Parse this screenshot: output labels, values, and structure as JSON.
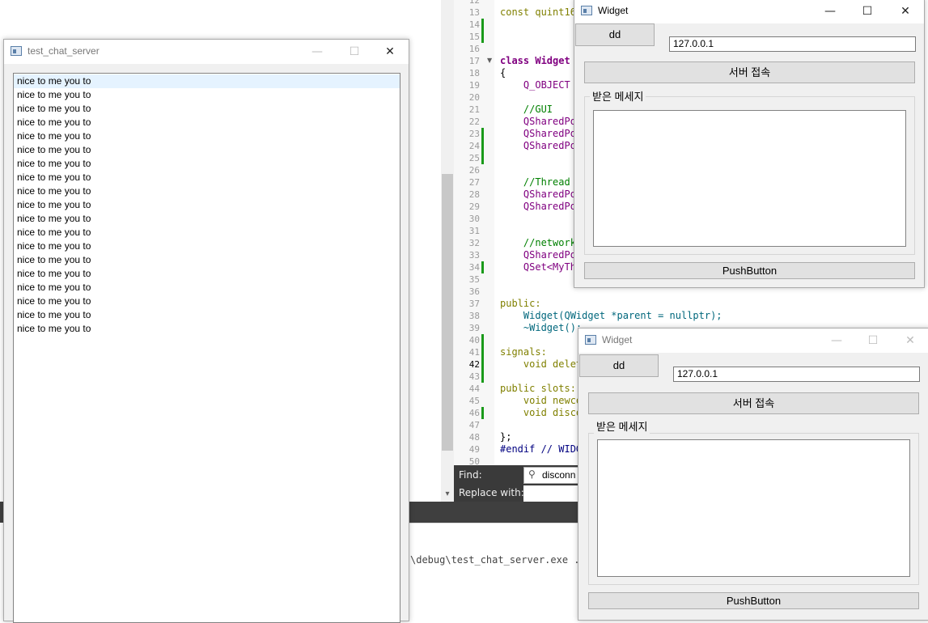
{
  "editor": {
    "lines": [
      {
        "no": "12",
        "code": ""
      },
      {
        "no": "13",
        "code": "const quint16"
      },
      {
        "no": "14",
        "code": ""
      },
      {
        "no": "15",
        "code": ""
      },
      {
        "no": "16",
        "code": ""
      },
      {
        "no": "17",
        "code": "class Widget"
      },
      {
        "no": "18",
        "code": "{"
      },
      {
        "no": "19",
        "code": "    Q_OBJECT"
      },
      {
        "no": "20",
        "code": ""
      },
      {
        "no": "21",
        "code": "    //GUI"
      },
      {
        "no": "22",
        "code": "    QSharedPo"
      },
      {
        "no": "23",
        "code": "    QSharedPo"
      },
      {
        "no": "24",
        "code": "    QSharedPo"
      },
      {
        "no": "25",
        "code": ""
      },
      {
        "no": "26",
        "code": ""
      },
      {
        "no": "27",
        "code": "    //Thread"
      },
      {
        "no": "28",
        "code": "    QSharedPo"
      },
      {
        "no": "29",
        "code": "    QSharedPo"
      },
      {
        "no": "30",
        "code": ""
      },
      {
        "no": "31",
        "code": ""
      },
      {
        "no": "32",
        "code": "    //network"
      },
      {
        "no": "33",
        "code": "    QSharedPo"
      },
      {
        "no": "34",
        "code": "    QSet<MyTh"
      },
      {
        "no": "35",
        "code": ""
      },
      {
        "no": "36",
        "code": ""
      },
      {
        "no": "37",
        "code": "public:"
      },
      {
        "no": "38",
        "code": "    Widget(QWidget *parent = nullptr);"
      },
      {
        "no": "39",
        "code": "    ~Widget();"
      },
      {
        "no": "40",
        "code": ""
      },
      {
        "no": "41",
        "code": "signals:"
      },
      {
        "no": "42",
        "code": "    void delet"
      },
      {
        "no": "43",
        "code": ""
      },
      {
        "no": "44",
        "code": "public slots:"
      },
      {
        "no": "45",
        "code": "    void newco"
      },
      {
        "no": "46",
        "code": "    void disco"
      },
      {
        "no": "47",
        "code": ""
      },
      {
        "no": "48",
        "code": "};"
      },
      {
        "no": "49",
        "code": "#endif // WIDG"
      },
      {
        "no": "50",
        "code": ""
      }
    ],
    "find_label": "Find:",
    "replace_label": "Replace with:",
    "find_value": "disconn",
    "output_line": "\\debug\\test_chat_server.exe ..."
  },
  "server_window": {
    "title": "test_chat_server",
    "items": [
      "nice to me you to",
      "nice to me you to",
      "nice to me you to",
      "nice to me you to",
      "nice to me you to",
      "nice to me you to",
      "nice to me you to",
      "nice to me you to",
      "nice to me you to",
      "nice to me you to",
      "nice to me you to",
      "nice to me you to",
      "nice to me you to",
      "nice to me you to",
      "nice to me you to",
      "nice to me you to",
      "nice to me you to",
      "nice to me you to",
      "nice to me you to"
    ]
  },
  "client_windows": [
    {
      "title": "Widget",
      "dd_label": "dd",
      "ip_value": "127.0.0.1",
      "connect_label": "서버 접속",
      "group_label": "받은 메세지",
      "push_label": "PushButton"
    },
    {
      "title": "Widget",
      "dd_label": "dd",
      "ip_value": "127.0.0.1",
      "connect_label": "서버 접속",
      "group_label": "받은 메세지",
      "push_label": "PushButton"
    }
  ],
  "icons": {
    "minimize": "minimize-icon",
    "maximize": "maximize-icon",
    "close": "close-icon",
    "search": "search-icon"
  }
}
